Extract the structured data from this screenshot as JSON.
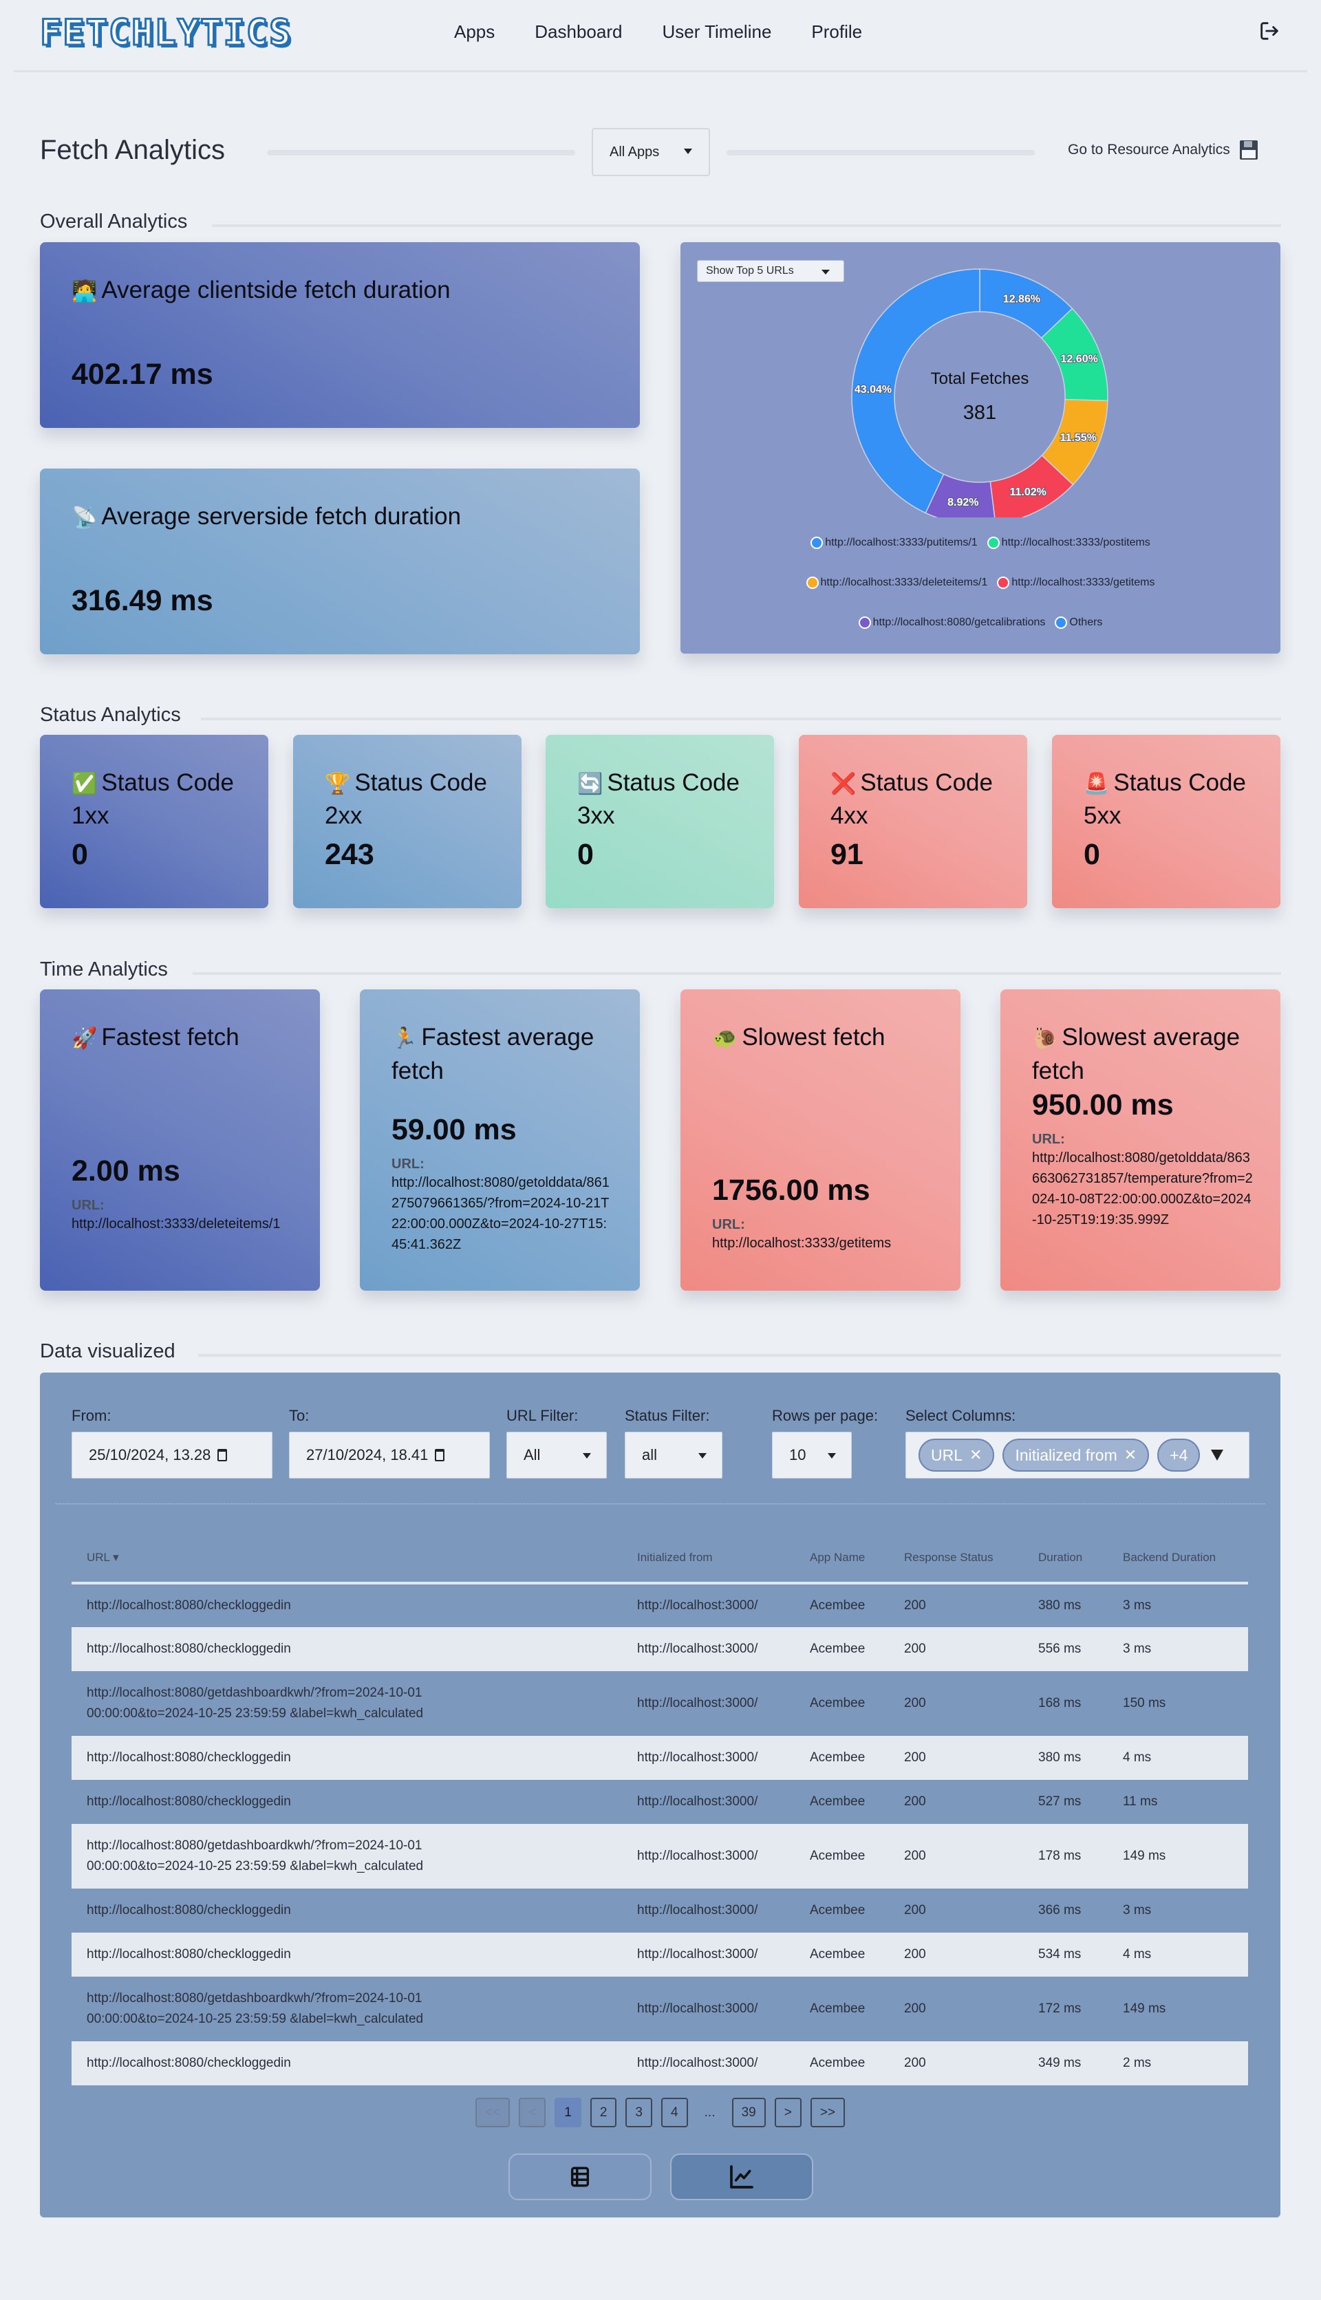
{
  "nav": {
    "logo": "FETCHLYTICS",
    "links": [
      "Apps",
      "Dashboard",
      "User Timeline",
      "Profile"
    ],
    "logout_icon": "logout-icon"
  },
  "header": {
    "title": "Fetch Analytics",
    "app_select": "All Apps",
    "resource_link": "Go to Resource Analytics",
    "resource_icon": "floppy-disk-icon"
  },
  "overall": {
    "section_title": "Overall Analytics",
    "client": {
      "emoji": "🧑‍💻",
      "title": "Average clientside fetch duration",
      "value": "402.17 ms"
    },
    "server": {
      "emoji": "📡",
      "title": "Average serverside fetch duration",
      "value": "316.49 ms"
    },
    "top_select": "Show Top 5 URLs"
  },
  "chart_data": {
    "type": "pie",
    "title": "Total Fetches",
    "center_label": "Total Fetches",
    "center_value": "381",
    "legend_position": "bottom",
    "slices": [
      {
        "label": "http://localhost:3333/putitems/1",
        "value": 12.86,
        "display": "12.86%",
        "color": "#3591f6"
      },
      {
        "label": "http://localhost:3333/postitems",
        "value": 12.6,
        "display": "12.60%",
        "color": "#20e098"
      },
      {
        "label": "http://localhost:3333/deleteitems/1",
        "value": 11.55,
        "display": "11.55%",
        "color": "#f7ac20"
      },
      {
        "label": "http://localhost:3333/getitems",
        "value": 11.02,
        "display": "11.02%",
        "color": "#f44155"
      },
      {
        "label": "http://localhost:8080/getcalibrations",
        "value": 8.92,
        "display": "8.92%",
        "color": "#7a5bcc"
      },
      {
        "label": "Others",
        "value": 43.04,
        "display": "43.04%",
        "color": "#3591f6"
      }
    ]
  },
  "status": {
    "section_title": "Status Analytics",
    "cards": [
      {
        "emoji": "✅",
        "title": "Status Code",
        "code": "1xx",
        "value": "0"
      },
      {
        "emoji": "🏆",
        "title": "Status Code",
        "code": "2xx",
        "value": "243"
      },
      {
        "emoji": "🔄",
        "title": "Status Code",
        "code": "3xx",
        "value": "0"
      },
      {
        "emoji": "❌",
        "title": "Status Code",
        "code": "4xx",
        "value": "91"
      },
      {
        "emoji": "🚨",
        "title": "Status Code",
        "code": "5xx",
        "value": "0"
      }
    ]
  },
  "time": {
    "section_title": "Time Analytics",
    "url_label": "URL:",
    "cards": [
      {
        "emoji": "🚀",
        "title": "Fastest fetch",
        "value": "2.00 ms",
        "url": "http://localhost:3333/deleteitems/1"
      },
      {
        "emoji": "🏃",
        "title": "Fastest average fetch",
        "value": "59.00 ms",
        "url": "http://localhost:8080/getolddata/861275079661365/?from=2024-10-21T22:00:00.000Z&to=2024-10-27T15:45:41.362Z"
      },
      {
        "emoji": "🐢",
        "title": "Slowest fetch",
        "value": "1756.00 ms",
        "url": "http://localhost:3333/getitems"
      },
      {
        "emoji": "🐌",
        "title": "Slowest average fetch",
        "value": "950.00 ms",
        "url": "http://localhost:8080/getolddata/863663062731857/temperature?from=2024-10-08T22:00:00.000Z&to=2024-10-25T19:19:35.999Z"
      }
    ]
  },
  "data": {
    "section_title": "Data visualized",
    "filters": {
      "from_label": "From:",
      "from_value": "25/10/2024, 13.28",
      "to_label": "To:",
      "to_value": "27/10/2024, 18.41",
      "url_label": "URL Filter:",
      "url_value": "All",
      "status_label": "Status Filter:",
      "status_value": "all",
      "rows_label": "Rows per page:",
      "rows_value": "10",
      "columns_label": "Select Columns:",
      "chips": [
        "URL",
        "Initialized from"
      ],
      "more_chip": "+4"
    },
    "columns": [
      "URL ▾",
      "Initialized from",
      "App Name",
      "Response Status",
      "Duration",
      "Backend Duration"
    ],
    "rows": [
      [
        "http://localhost:8080/checkloggedin",
        "http://localhost:3000/",
        "Acembee",
        "200",
        "380 ms",
        "3 ms"
      ],
      [
        "http://localhost:8080/checkloggedin",
        "http://localhost:3000/",
        "Acembee",
        "200",
        "556 ms",
        "3 ms"
      ],
      [
        "http://localhost:8080/getdashboardkwh/?from=2024-10-01 00:00:00&to=2024-10-25 23:59:59 &label=kwh_calculated",
        "http://localhost:3000/",
        "Acembee",
        "200",
        "168 ms",
        "150 ms"
      ],
      [
        "http://localhost:8080/checkloggedin",
        "http://localhost:3000/",
        "Acembee",
        "200",
        "380 ms",
        "4 ms"
      ],
      [
        "http://localhost:8080/checkloggedin",
        "http://localhost:3000/",
        "Acembee",
        "200",
        "527 ms",
        "11 ms"
      ],
      [
        "http://localhost:8080/getdashboardkwh/?from=2024-10-01 00:00:00&to=2024-10-25 23:59:59 &label=kwh_calculated",
        "http://localhost:3000/",
        "Acembee",
        "200",
        "178 ms",
        "149 ms"
      ],
      [
        "http://localhost:8080/checkloggedin",
        "http://localhost:3000/",
        "Acembee",
        "200",
        "366 ms",
        "3 ms"
      ],
      [
        "http://localhost:8080/checkloggedin",
        "http://localhost:3000/",
        "Acembee",
        "200",
        "534 ms",
        "4 ms"
      ],
      [
        "http://localhost:8080/getdashboardkwh/?from=2024-10-01 00:00:00&to=2024-10-25 23:59:59 &label=kwh_calculated",
        "http://localhost:3000/",
        "Acembee",
        "200",
        "172 ms",
        "149 ms"
      ],
      [
        "http://localhost:8080/checkloggedin",
        "http://localhost:3000/",
        "Acembee",
        "200",
        "349 ms",
        "2 ms"
      ]
    ],
    "pagination": {
      "first": "<<",
      "prev": "<",
      "pages": [
        "1",
        "2",
        "3",
        "4"
      ],
      "ellipsis": "...",
      "last_page": "39",
      "next": ">",
      "last": ">>",
      "current": "1"
    },
    "view_buttons": [
      {
        "icon": "table-icon",
        "active": false
      },
      {
        "icon": "line-chart-icon",
        "active": true
      }
    ]
  }
}
